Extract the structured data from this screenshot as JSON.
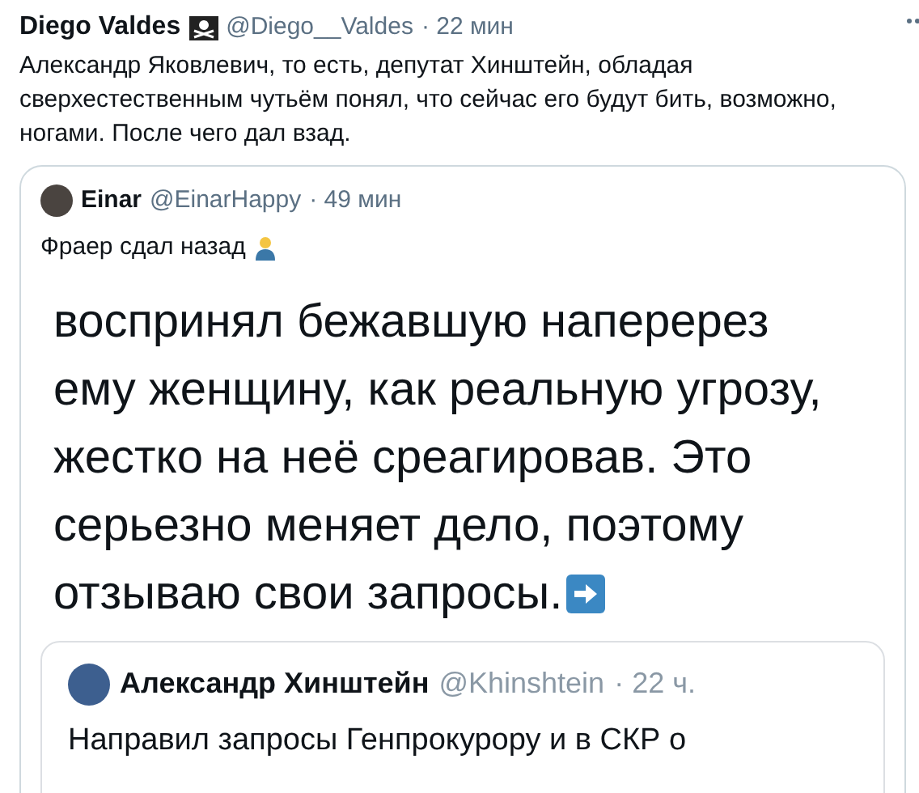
{
  "tweet": {
    "name": "Diego Valdes",
    "handle": "@Diego__Valdes",
    "time": "· 22 мин",
    "text": "Александр Яковлевич, то есть, депутат Хинштейн, обладая сверхестественным чутьём понял, что сейчас его будут бить, возможно, ногами. После чего дал взад."
  },
  "quoted": {
    "name": "Einar",
    "handle": "@EinarHappy",
    "time": "· 49 мин",
    "text": "Фраер сдал назад",
    "screenshot": {
      "lines": [
        "воспринял бежавшую наперерез",
        "ему женщину, как реальную угрозу,",
        "жестко на неё среагировав. Это",
        "серьезно меняет дело, поэтому",
        "отзываю свои запросы."
      ],
      "inner": {
        "name": "Александр Хинштейн",
        "handle": "@Khinshtein",
        "time": "· 22 ч.",
        "text": "Направил запросы Генпрокурору и в СКР о"
      }
    }
  }
}
